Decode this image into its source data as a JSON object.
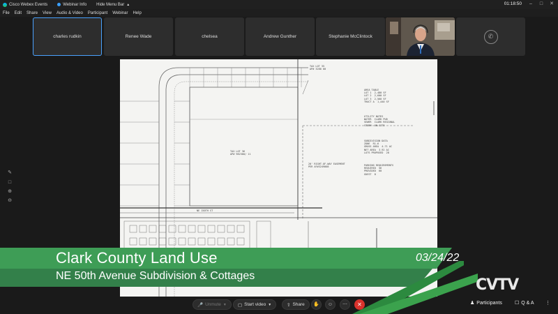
{
  "topbar": {
    "app_name": "Cisco Webex Events",
    "webinar_info": "Webinar Info",
    "hide_menu": "Hide Menu Bar",
    "clock": "01:18:50",
    "win_minimize": "–",
    "win_maximize": "□",
    "win_close": "✕"
  },
  "menu": [
    "File",
    "Edit",
    "Share",
    "View",
    "Audio & Video",
    "Participant",
    "Webinar",
    "Help"
  ],
  "participants": [
    {
      "name": "charles rudkin",
      "active": true
    },
    {
      "name": "Renee Wade"
    },
    {
      "name": "chelsea"
    },
    {
      "name": "Andrew Gunther"
    },
    {
      "name": "Stephanie McClintock"
    }
  ],
  "document": {
    "lot_top": "TAX LOT 35\nAP# 3280 00",
    "lot_center": "TAX LOT 36\nAP# 982300/ 11",
    "easement": "20' RIGHT-OF-WAY EASEMENT\nPER AF#3249008",
    "street": "NE 150TH ST",
    "legend_blocks": [
      "AREA TABLE\nLOT 1  2,480 SF\nLOT 2  2,600 SF\nLOT 3  2,560 SF\nTRACT A  1,440 SF",
      "UTILITY NOTES\nWATER  CLARK PUD\nSEWER  CLARK REGIONAL\nSTORM  ON-SITE",
      "SUBDIVISION DATA\nZONE  R1-6\nGROSS AREA  4.71 AC\nNET AREA  3.92 AC\nLOTS PROPOSED  28",
      "PARKING REQUIREMENTS\nREQUIRED  56\nPROVIDED  60\nGUEST  8"
    ]
  },
  "banner": {
    "title": "Clark County Land Use",
    "subtitle": "NE 50th Avenue Subdivision & Cottages",
    "date": "03/24/22",
    "logo": "CVTV"
  },
  "toolbar": {
    "unmute": "Unmute",
    "start_video": "Start video",
    "share": "Share",
    "participants": "Participants",
    "qa": "Q & A"
  }
}
